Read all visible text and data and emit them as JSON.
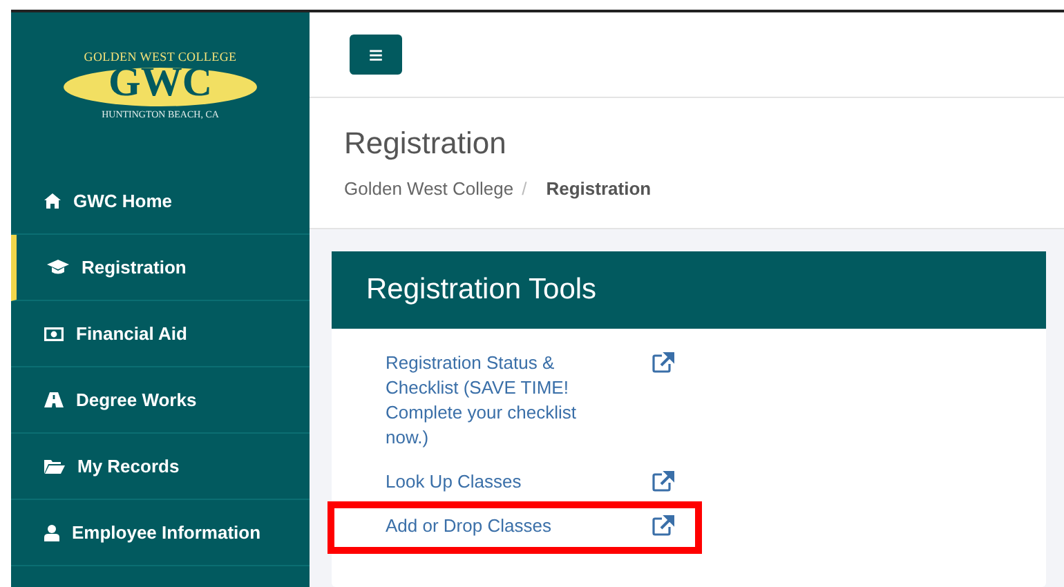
{
  "logo": {
    "top": "GOLDEN WEST COLLEGE",
    "mark": "GWC",
    "bottom": "HUNTINGTON BEACH, CA"
  },
  "sidebar": {
    "items": [
      {
        "label": "GWC Home",
        "selected": false
      },
      {
        "label": "Registration",
        "selected": true
      },
      {
        "label": "Financial Aid",
        "selected": false
      },
      {
        "label": "Degree Works",
        "selected": false
      },
      {
        "label": "My Records",
        "selected": false
      },
      {
        "label": "Employee Information",
        "selected": false
      }
    ]
  },
  "header": {
    "menu_button": "≡"
  },
  "page": {
    "title": "Registration",
    "breadcrumb_separator": "/",
    "breadcrumb": [
      {
        "label": "Golden West College",
        "current": false
      },
      {
        "label": "Registration",
        "current": true
      }
    ]
  },
  "card": {
    "title": "Registration Tools",
    "links": [
      {
        "label": "Registration Status & Checklist (SAVE TIME! Complete your checklist now.)",
        "highlighted": false
      },
      {
        "label": "Look Up Classes",
        "highlighted": false
      },
      {
        "label": "Add or Drop Classes",
        "highlighted": true
      }
    ]
  }
}
